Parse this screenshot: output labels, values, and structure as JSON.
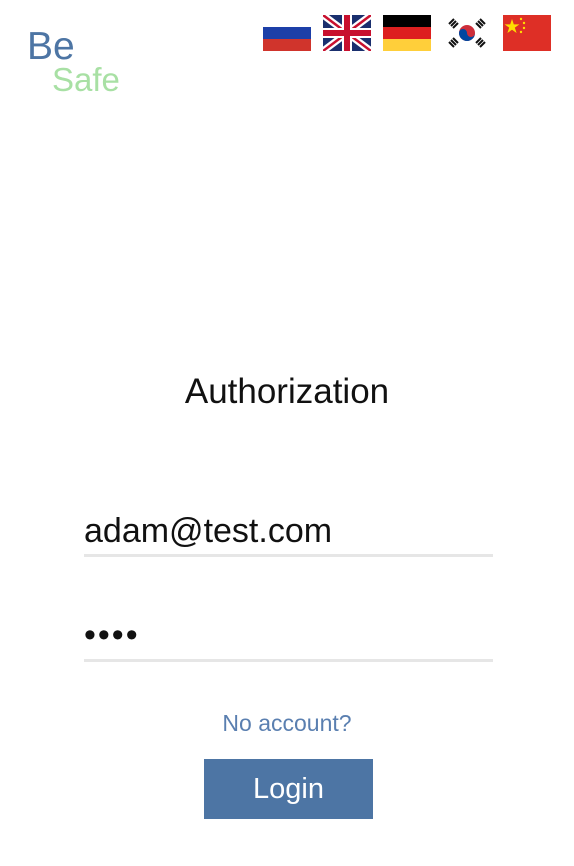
{
  "logo": {
    "line1": "Be",
    "line2": "Safe",
    "line1_color": "#4d75a4",
    "line2_color": "#a8e0a4"
  },
  "languages": [
    {
      "icon": "russia-flag-icon"
    },
    {
      "icon": "uk-flag-icon"
    },
    {
      "icon": "germany-flag-icon"
    },
    {
      "icon": "south-korea-flag-icon"
    },
    {
      "icon": "china-flag-icon"
    }
  ],
  "form": {
    "title": "Authorization",
    "email_value": "adam@test.com",
    "password_value": "1234",
    "no_account_label": "No account?",
    "login_label": "Login"
  },
  "colors": {
    "accent": "#4d75a4",
    "link": "#5a7fb0",
    "field_underline": "#e6e6e6"
  }
}
